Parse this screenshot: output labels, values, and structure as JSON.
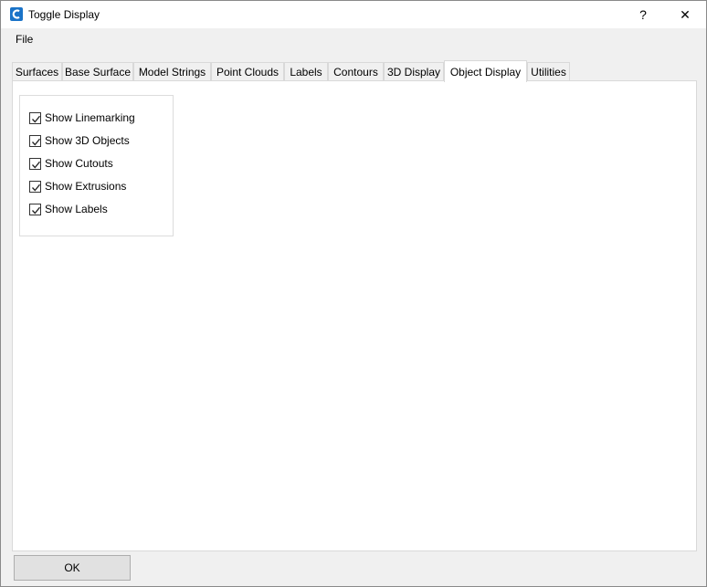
{
  "window": {
    "title": "Toggle Display",
    "help_label": "?",
    "close_label": "✕",
    "icon_color": "#1a73c8"
  },
  "menu": {
    "items": [
      {
        "label": "File"
      }
    ]
  },
  "tabs": [
    {
      "label": "Surfaces"
    },
    {
      "label": "Base Surface"
    },
    {
      "label": "Model Strings"
    },
    {
      "label": "Point Clouds"
    },
    {
      "label": "Labels"
    },
    {
      "label": "Contours"
    },
    {
      "label": "3D Display"
    },
    {
      "label": "Object Display",
      "active": true
    },
    {
      "label": "Utilities"
    }
  ],
  "object_display": {
    "options": [
      {
        "label": "Show Linemarking",
        "checked": true
      },
      {
        "label": "Show 3D Objects",
        "checked": true
      },
      {
        "label": "Show Cutouts",
        "checked": true
      },
      {
        "label": "Show Extrusions",
        "checked": true
      },
      {
        "label": "Show Labels",
        "checked": true
      }
    ]
  },
  "footer": {
    "ok_label": "OK"
  }
}
